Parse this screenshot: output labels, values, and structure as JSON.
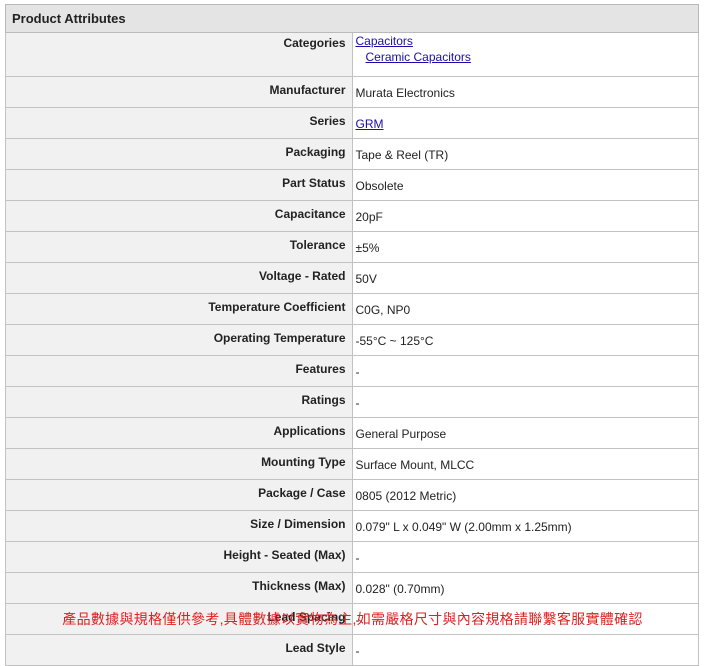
{
  "table": {
    "title": "Product Attributes",
    "rows": [
      {
        "label": "Categories",
        "value": "Capacitors",
        "value2": "Ceramic Capacitors"
      },
      {
        "label": "Manufacturer",
        "value": "Murata Electronics"
      },
      {
        "label": "Series",
        "value": "GRM"
      },
      {
        "label": "Packaging",
        "value": "Tape & Reel (TR)"
      },
      {
        "label": "Part Status",
        "value": "Obsolete"
      },
      {
        "label": "Capacitance",
        "value": "20pF"
      },
      {
        "label": "Tolerance",
        "value": "±5%"
      },
      {
        "label": "Voltage - Rated",
        "value": "50V"
      },
      {
        "label": "Temperature Coefficient",
        "value": "C0G, NP0"
      },
      {
        "label": "Operating Temperature",
        "value": "-55°C ~ 125°C"
      },
      {
        "label": "Features",
        "value": "-"
      },
      {
        "label": "Ratings",
        "value": "-"
      },
      {
        "label": "Applications",
        "value": "General Purpose"
      },
      {
        "label": "Mounting Type",
        "value": "Surface Mount, MLCC"
      },
      {
        "label": "Package / Case",
        "value": "0805 (2012 Metric)"
      },
      {
        "label": "Size / Dimension",
        "value": "0.079\" L x 0.049\" W (2.00mm x 1.25mm)"
      },
      {
        "label": "Height - Seated (Max)",
        "value": "-"
      },
      {
        "label": "Thickness (Max)",
        "value": "0.028\" (0.70mm)"
      },
      {
        "label": "Lead Spacing",
        "value": "-"
      },
      {
        "label": "Lead Style",
        "value": "-"
      }
    ]
  },
  "disclaimer": "產品數據與規格僅供參考,具體數據以實物為主,如需嚴格尺寸與內容規格請聯繫客服實體確認",
  "colors": {
    "header_bg": "#e4e4e4",
    "label_bg": "#f1f1f1",
    "link": "#1a0dab",
    "disclaimer": "#e02020"
  }
}
